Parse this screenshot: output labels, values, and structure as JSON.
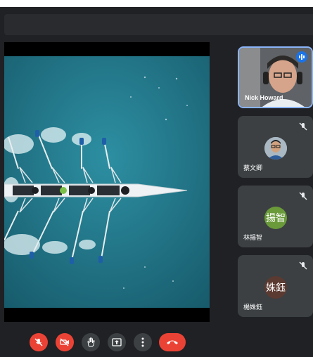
{
  "participants": [
    {
      "name": "Nick Howard",
      "speaking": true
    },
    {
      "name": "蔡文卿",
      "muted": true
    },
    {
      "name": "林揚智",
      "muted": true,
      "initials": "揚智",
      "avatar_color": "#6a9a3a"
    },
    {
      "name": "楊姝鈺",
      "muted": true,
      "initials": "姝鈺",
      "avatar_color": "#5b3a31"
    }
  ],
  "controls": [
    {
      "name": "microphone-off",
      "icon": "mic-off-icon"
    },
    {
      "name": "camera-off",
      "icon": "camera-off-icon"
    },
    {
      "name": "raise-hand",
      "icon": "hand-icon"
    },
    {
      "name": "present",
      "icon": "present-icon"
    },
    {
      "name": "more-options",
      "icon": "more-vert-icon"
    },
    {
      "name": "leave-call",
      "icon": "phone-hangup-icon"
    }
  ],
  "colors": {
    "background": "#202124",
    "tile": "#3c4043",
    "danger": "#ea4335",
    "accent": "#8ab4f8"
  }
}
